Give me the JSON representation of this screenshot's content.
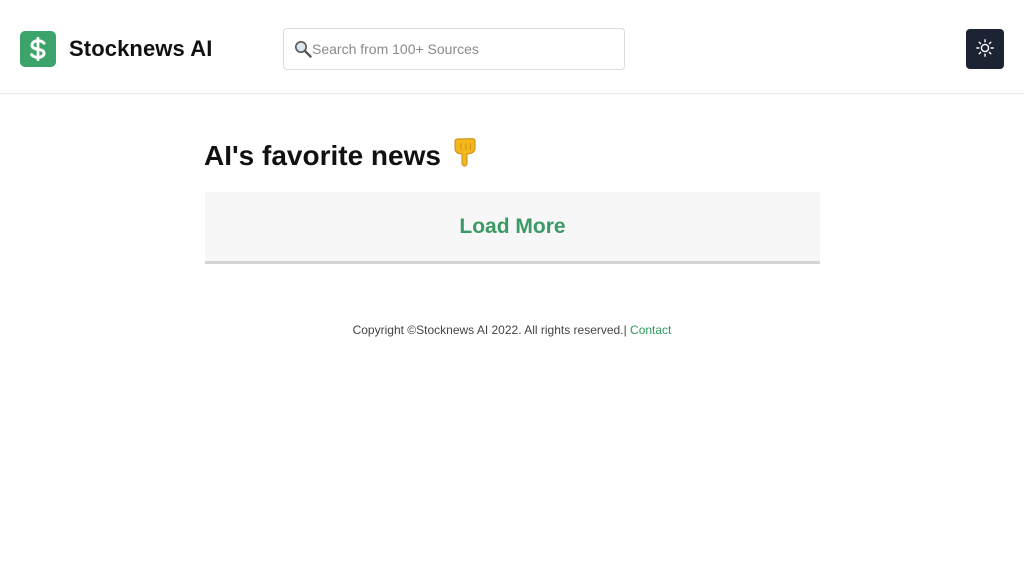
{
  "header": {
    "brand_name": "Stocknews AI",
    "logo_icon": "dollar-sign-icon",
    "search": {
      "placeholder": "Search from 100+ Sources",
      "value": ""
    },
    "theme_toggle_icon": "sun-icon"
  },
  "main": {
    "headline": "AI's favorite news",
    "headline_icon": "pointing-down-hand-icon",
    "load_more_label": "Load More"
  },
  "footer": {
    "copyright": "Copyright ©Stocknews AI 2022. All rights reserved.|",
    "contact_label": "Contact"
  },
  "colors": {
    "brand_green": "#3aa46a",
    "accent_green": "#3b9a64",
    "dark_button": "#1c2333"
  }
}
